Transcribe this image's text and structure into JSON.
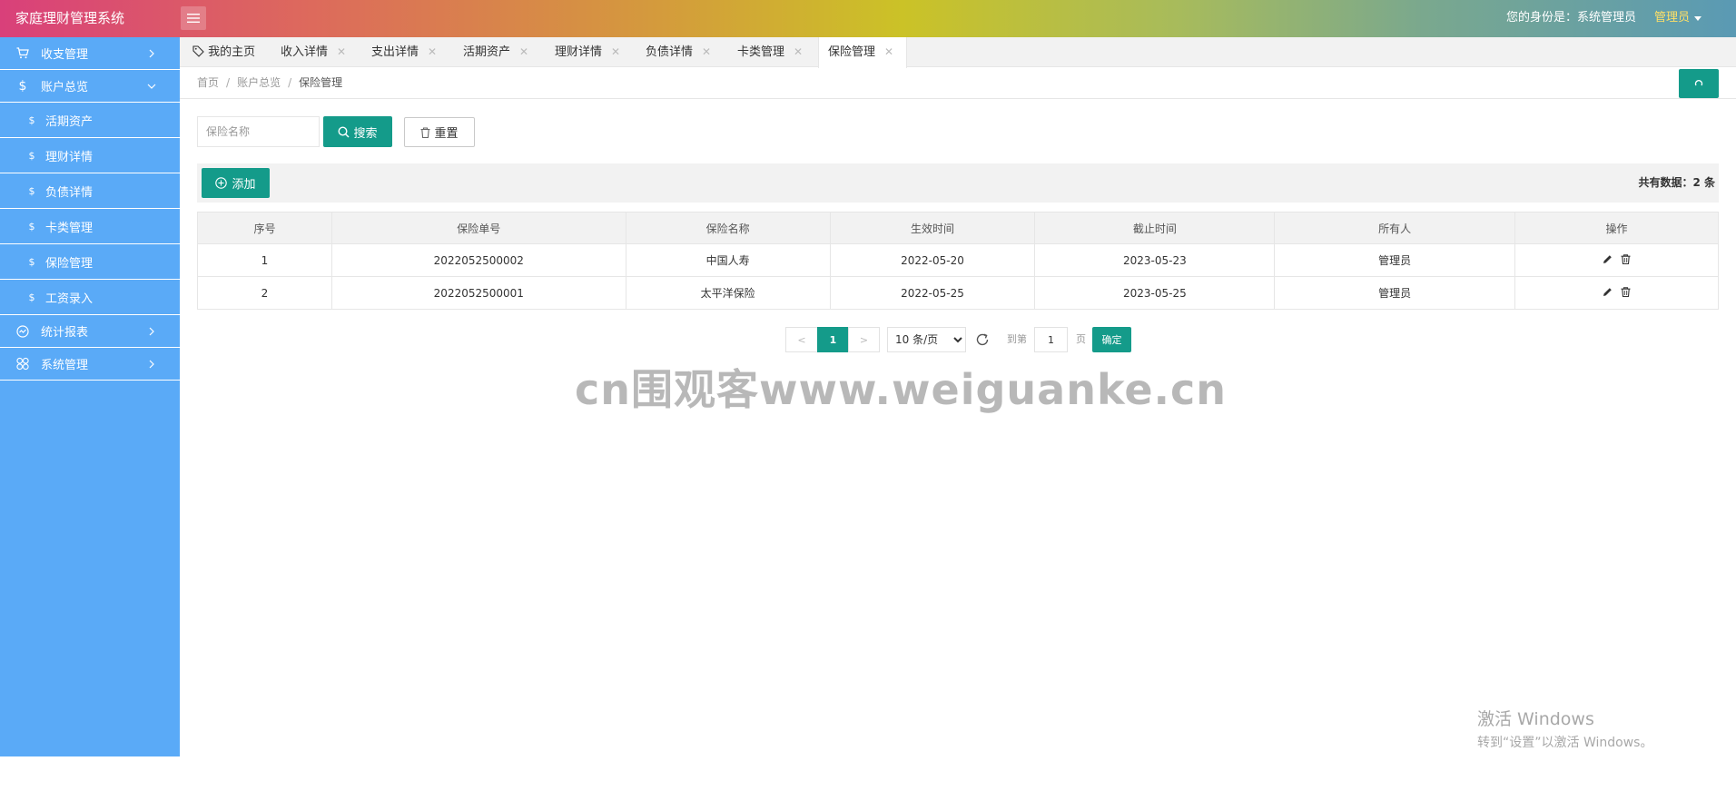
{
  "header": {
    "brand": "家庭理财管理系统",
    "identity": "您的身份是：系统管理员",
    "user": "管理员"
  },
  "sidebar": {
    "items": [
      {
        "label": "收支管理",
        "icon": "cart-icon"
      },
      {
        "label": "账户总览",
        "icon": "dollar-icon"
      },
      {
        "label": "活期资产",
        "icon": "dollar-icon"
      },
      {
        "label": "理财详情",
        "icon": "dollar-icon"
      },
      {
        "label": "负债详情",
        "icon": "dollar-icon"
      },
      {
        "label": "卡类管理",
        "icon": "dollar-icon"
      },
      {
        "label": "保险管理",
        "icon": "dollar-icon"
      },
      {
        "label": "工资录入",
        "icon": "dollar-icon"
      },
      {
        "label": "统计报表",
        "icon": "chart-icon"
      },
      {
        "label": "系统管理",
        "icon": "app-grid-icon"
      }
    ]
  },
  "tabs": [
    {
      "label": "我的主页"
    },
    {
      "label": "收入详情"
    },
    {
      "label": "支出详情"
    },
    {
      "label": "活期资产"
    },
    {
      "label": "理财详情"
    },
    {
      "label": "负债详情"
    },
    {
      "label": "卡类管理"
    },
    {
      "label": "保险管理"
    }
  ],
  "breadcrumb": [
    "首页",
    "账户总览",
    "保险管理"
  ],
  "search": {
    "placeholder": "保险名称",
    "search_label": "搜索",
    "reset_label": "重置"
  },
  "toolbar": {
    "add_label": "添加",
    "total_text": "共有数据：2 条"
  },
  "table": {
    "headers": [
      "序号",
      "保险单号",
      "保险名称",
      "生效时间",
      "截止时间",
      "所有人",
      "操作"
    ],
    "rows": [
      [
        "1",
        "2022052500002",
        "中国人寿",
        "2022-05-20",
        "2023-05-23",
        "管理员"
      ],
      [
        "2",
        "2022052500001",
        "太平洋保险",
        "2022-05-25",
        "2023-05-25",
        "管理员"
      ]
    ]
  },
  "pager": {
    "prev": "<",
    "current": "1",
    "next": ">",
    "page_size": "10 条/页",
    "goto_label": "到第",
    "goto_value": "1",
    "page_unit": "页",
    "confirm": "确定"
  },
  "watermark": "cn围观客www.weiguanke.cn",
  "windows_notice": {
    "line1": "激活 Windows",
    "line2": "转到“设置”以激活 Windows。"
  },
  "colors": {
    "accent": "#149b8a",
    "sidebar": "#5aaaf7",
    "user_highlight": "#ffe066"
  }
}
